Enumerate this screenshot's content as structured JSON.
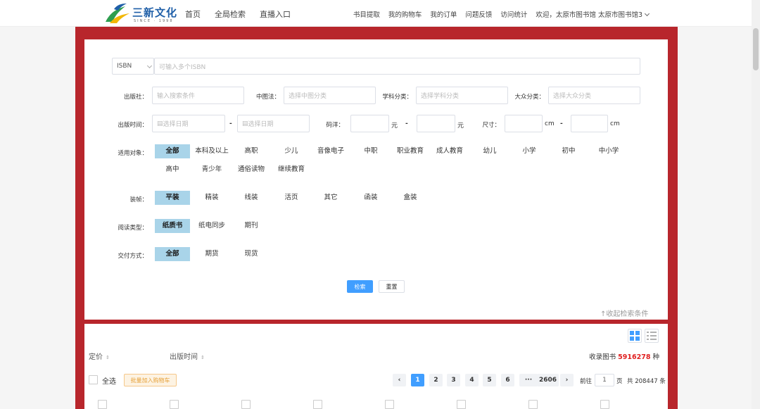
{
  "header": {
    "logo_text": "三新文化",
    "logo_sub": "SINCE · 1998",
    "nav_left": [
      "首页",
      "全局检索",
      "直播入口"
    ],
    "nav_right": [
      "书目提取",
      "我的购物车",
      "我的订单",
      "问题反馈",
      "访问统计"
    ],
    "welcome": "欢迎，太原市图书馆 太原市图书馆3"
  },
  "search": {
    "isbn_type": "ISBN",
    "isbn_placeholder": "可输入多个ISBN",
    "publisher_label": "出版社：",
    "publisher_placeholder": "输入搜索条件",
    "clc_label": "中图法：",
    "clc_placeholder": "选择中图分类",
    "subject_label": "学科分类：",
    "subject_placeholder": "选择学科分类",
    "public_label": "大众分类：",
    "public_placeholder": "选择大众分类",
    "pubdate_label": "出版时间：",
    "date_placeholder": "选择日期",
    "dash": "-",
    "price_label": "码洋：",
    "yuan": "元",
    "size_label": "尺寸：",
    "cm": "cm",
    "audience_label": "适用对象：",
    "audience_options": [
      "全部",
      "本科及以上",
      "高职",
      "少儿",
      "音像电子",
      "中职",
      "职业教育",
      "成人教育",
      "幼儿",
      "小学",
      "初中",
      "中小学",
      "高中",
      "青少年",
      "通俗读物",
      "继续教育"
    ],
    "binding_label": "装帧：",
    "binding_options": [
      "平装",
      "精装",
      "线装",
      "活页",
      "其它",
      "函装",
      "盒装"
    ],
    "read_label": "阅读类型：",
    "read_options": [
      "纸质书",
      "纸电同步",
      "期刊"
    ],
    "delivery_label": "交付方式：",
    "delivery_options": [
      "全部",
      "期货",
      "现货"
    ],
    "search_btn": "检索",
    "reset_btn": "重置",
    "collapse": "↑收起检索条件"
  },
  "results": {
    "sort_price": "定价",
    "sort_date": "出版时间",
    "total_prefix": "收录图书",
    "total_count": "5916278",
    "total_suffix": "种",
    "select_all": "全选",
    "batch_add": "批量加入购物车",
    "pages": [
      "1",
      "2",
      "3",
      "4",
      "5",
      "6",
      "···",
      "2606"
    ],
    "goto_prefix": "前往",
    "goto_value": "1",
    "goto_suffix": "页",
    "total_items": "共 208447 条"
  }
}
